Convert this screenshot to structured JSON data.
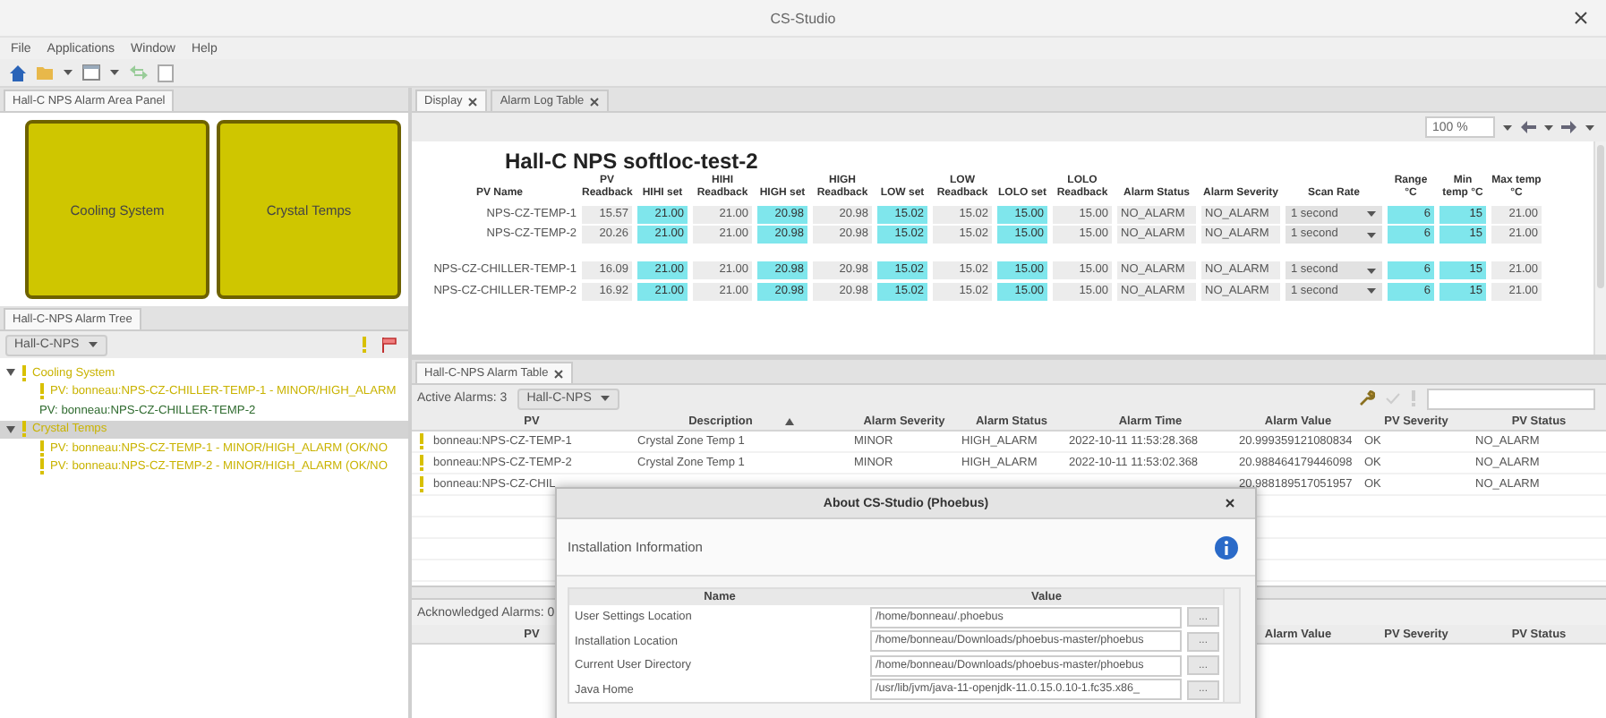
{
  "window": {
    "title": "CS-Studio"
  },
  "menu": [
    "File",
    "Applications",
    "Window",
    "Help"
  ],
  "area_panel": {
    "tab": "Hall-C NPS Alarm Area Panel",
    "areas": [
      {
        "label": "Cooling System",
        "in_alarm": true
      },
      {
        "label": "Crystal Temps",
        "in_alarm": true
      }
    ]
  },
  "alarm_tree": {
    "tab": "Hall-C-NPS Alarm Tree",
    "config": "Hall-C-NPS",
    "nodes": [
      {
        "label": "Cooling System",
        "in_alarm": true,
        "expanded": true,
        "selected": false,
        "children": [
          {
            "label": "PV: bonneau:NPS-CZ-CHILLER-TEMP-1 - MINOR/HIGH_ALARM",
            "in_alarm": true,
            "selected": false
          },
          {
            "label": "PV: bonneau:NPS-CZ-CHILLER-TEMP-2",
            "in_alarm": false,
            "selected": false
          }
        ]
      },
      {
        "label": "Crystal Temps",
        "in_alarm": true,
        "expanded": true,
        "selected": true,
        "children": [
          {
            "label": "PV: bonneau:NPS-CZ-TEMP-1 - MINOR/HIGH_ALARM (OK/NO",
            "in_alarm": true,
            "selected": false
          },
          {
            "label": "PV: bonneau:NPS-CZ-TEMP-2 - MINOR/HIGH_ALARM (OK/NO",
            "in_alarm": true,
            "selected": false
          }
        ]
      }
    ]
  },
  "display": {
    "tabs": [
      {
        "label": "Display",
        "selected": true
      },
      {
        "label": "Alarm Log Table",
        "selected": false
      }
    ],
    "zoom": "100 %",
    "title": "Hall-C NPS softloc-test-2",
    "columns": [
      {
        "label": "PV Name",
        "kind": "name"
      },
      {
        "label": "PV Readback",
        "kind": "readback"
      },
      {
        "label": "HIHI set",
        "kind": "setpoint"
      },
      {
        "label": "HIHI Readback",
        "kind": "readback"
      },
      {
        "label": "HIGH set",
        "kind": "setpoint"
      },
      {
        "label": "HIGH Readback",
        "kind": "readback"
      },
      {
        "label": "LOW set",
        "kind": "setpoint"
      },
      {
        "label": "LOW Readback",
        "kind": "readback"
      },
      {
        "label": "LOLO set",
        "kind": "setpoint"
      },
      {
        "label": "LOLO Readback",
        "kind": "readback"
      },
      {
        "label": "Alarm Status",
        "kind": "status"
      },
      {
        "label": "Alarm Severity",
        "kind": "status"
      },
      {
        "label": "Scan Rate",
        "kind": "combo"
      },
      {
        "label": "Range °C",
        "kind": "setpoint"
      },
      {
        "label": "Min temp °C",
        "kind": "setpoint"
      },
      {
        "label": "Max temp °C",
        "kind": "readback"
      }
    ],
    "groups": [
      {
        "rows": [
          [
            "NPS-CZ-TEMP-1",
            "15.57",
            "21.00",
            "21.00",
            "20.98",
            "20.98",
            "15.02",
            "15.02",
            "15.00",
            "15.00",
            "NO_ALARM",
            "NO_ALARM",
            "1 second",
            "6",
            "15",
            "21.00"
          ],
          [
            "NPS-CZ-TEMP-2",
            "20.26",
            "21.00",
            "21.00",
            "20.98",
            "20.98",
            "15.02",
            "15.02",
            "15.00",
            "15.00",
            "NO_ALARM",
            "NO_ALARM",
            "1 second",
            "6",
            "15",
            "21.00"
          ]
        ]
      },
      {
        "rows": [
          [
            "NPS-CZ-CHILLER-TEMP-1",
            "16.09",
            "21.00",
            "21.00",
            "20.98",
            "20.98",
            "15.02",
            "15.02",
            "15.00",
            "15.00",
            "NO_ALARM",
            "NO_ALARM",
            "1 second",
            "6",
            "15",
            "21.00"
          ],
          [
            "NPS-CZ-CHILLER-TEMP-2",
            "16.92",
            "21.00",
            "21.00",
            "20.98",
            "20.98",
            "15.02",
            "15.02",
            "15.00",
            "15.00",
            "NO_ALARM",
            "NO_ALARM",
            "1 second",
            "6",
            "15",
            "21.00"
          ]
        ]
      }
    ]
  },
  "alarm_table": {
    "tab": "Hall-C-NPS Alarm Table",
    "active_label": "Active Alarms: 3",
    "config": "Hall-C-NPS",
    "columns": [
      {
        "label": "PV"
      },
      {
        "label": "Description",
        "sorted": true
      },
      {
        "label": "Alarm Severity"
      },
      {
        "label": "Alarm Status"
      },
      {
        "label": "Alarm Time"
      },
      {
        "label": "Alarm Value"
      },
      {
        "label": "PV Severity"
      },
      {
        "label": "PV Status"
      }
    ],
    "rows": [
      {
        "in_alarm": true,
        "pv": "bonneau:NPS-CZ-TEMP-1",
        "description": "Crystal Zone Temp 1",
        "alarm_severity": "MINOR",
        "alarm_status": "HIGH_ALARM",
        "alarm_time": "2022-10-11 11:53:28.368",
        "alarm_value": "20.999359121080834",
        "pv_severity": "OK",
        "pv_status": "NO_ALARM"
      },
      {
        "in_alarm": true,
        "pv": "bonneau:NPS-CZ-TEMP-2",
        "description": "Crystal Zone Temp 1",
        "alarm_severity": "MINOR",
        "alarm_status": "HIGH_ALARM",
        "alarm_time": "2022-10-11 11:53:02.368",
        "alarm_value": "20.988464179446098",
        "pv_severity": "OK",
        "pv_status": "NO_ALARM"
      },
      {
        "in_alarm": true,
        "pv": "bonneau:NPS-CZ-CHIL",
        "alarm_value": "20.988189517051957",
        "pv_severity": "OK",
        "pv_status": "NO_ALARM"
      }
    ],
    "acknowledged_label": "Acknowledged Alarms: 0",
    "acknowledged_columns": [
      "PV",
      "Alarm Value",
      "PV Severity",
      "PV Status"
    ]
  },
  "dialog": {
    "title": "About CS-Studio (Phoebus)",
    "heading": "Installation Information",
    "columns": [
      "Name",
      "Value"
    ],
    "rows": [
      {
        "name": "User Settings Location",
        "value": "/home/bonneau/.phoebus",
        "button": "..."
      },
      {
        "name": "Installation Location",
        "value": "/home/bonneau/Downloads/phoebus-master/phoebus",
        "button": "..."
      },
      {
        "name": "Current User Directory",
        "value": "/home/bonneau/Downloads/phoebus-master/phoebus",
        "button": "..."
      },
      {
        "name": "Java Home",
        "value": "/usr/lib/jvm/java-11-openjdk-11.0.15.0.10-1.fc35.x86_",
        "button": "..."
      }
    ]
  }
}
